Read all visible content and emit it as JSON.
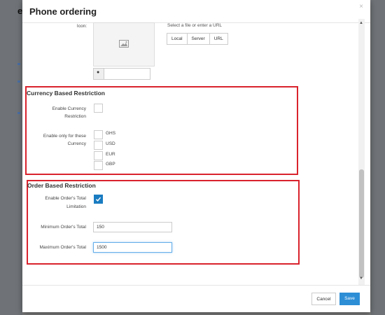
{
  "background": {
    "partial_letter": "e"
  },
  "modal": {
    "title": "Phone ordering",
    "close_label": "×"
  },
  "icon_field": {
    "label": "Icon:",
    "hint": "Select a file or enter a URL",
    "buttons": [
      "Local",
      "Server",
      "URL"
    ],
    "image_placeholder_icon": "image-icon",
    "comment_icon": "comment-icon"
  },
  "currency_section": {
    "title": "Currency Based Restriction",
    "enable_label_line1": "Enable Currency",
    "enable_label_line2": "Restriction",
    "enable_checked": false,
    "only_for_label_line1": "Enable only for these",
    "only_for_label_line2": "Currency",
    "currencies": [
      {
        "code": "GHS",
        "checked": false
      },
      {
        "code": "USD",
        "checked": false
      },
      {
        "code": "EUR",
        "checked": false
      },
      {
        "code": "GBP",
        "checked": false
      }
    ]
  },
  "order_section": {
    "title": "Order Based Restriction",
    "enable_label_line1": "Enable Order's Total",
    "enable_label_line2": "Limitation",
    "enable_checked": true,
    "min_label": "Minimum Order's Total",
    "min_value": "150",
    "max_label": "Maximum Order's Total",
    "max_value": "1500"
  },
  "footer": {
    "cancel_label": "Cancel",
    "save_label": "Save"
  },
  "colors": {
    "accent": "#2d8ed6",
    "highlight_border": "#d9232d"
  }
}
